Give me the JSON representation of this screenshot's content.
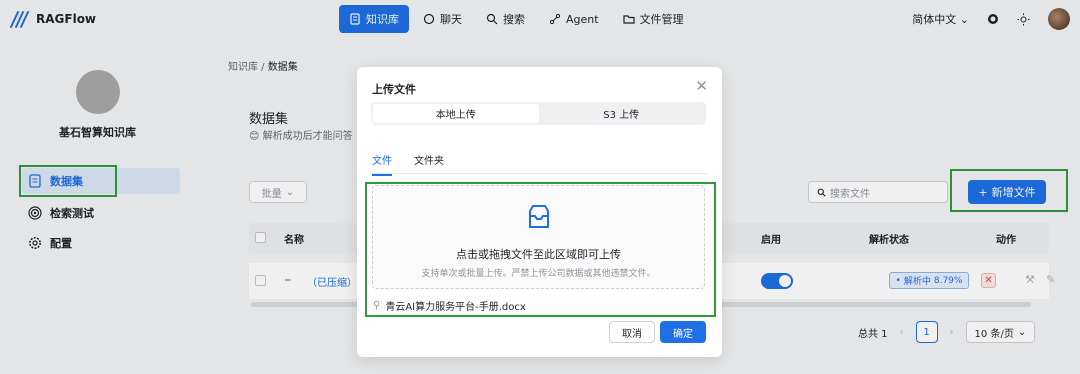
{
  "app": {
    "name": "RAGFlow"
  },
  "nav": {
    "items": [
      {
        "label": "知识库",
        "icon": "database-icon",
        "active": true
      },
      {
        "label": "聊天",
        "icon": "chat-icon"
      },
      {
        "label": "搜索",
        "icon": "search-icon"
      },
      {
        "label": "Agent",
        "icon": "agent-icon"
      },
      {
        "label": "文件管理",
        "icon": "folder-icon"
      }
    ],
    "language": "简体中文",
    "accent": "#1f6fe5"
  },
  "sidebar": {
    "kb_name": "基石智算知识库",
    "items": [
      {
        "label": "数据集",
        "icon": "dataset-icon",
        "active": true
      },
      {
        "label": "检索测试",
        "icon": "target-icon"
      },
      {
        "label": "配置",
        "icon": "gear-icon"
      }
    ]
  },
  "main": {
    "breadcrumb": {
      "root": "知识库",
      "current": "数据集"
    },
    "title": "数据集",
    "subtitle": "解析成功后才能问答",
    "batch_label": "批量",
    "search_placeholder": "搜索文件",
    "new_file_label": "新增文件",
    "table": {
      "headers": {
        "name": "名称",
        "enable": "启用",
        "parse_status": "解析状态",
        "action": "动作"
      },
      "rows": [
        {
          "name": "（已压缩）基",
          "enabled": true,
          "status_label": "解析中",
          "progress": "8.79%"
        }
      ]
    },
    "pagination": {
      "total": "总共 1",
      "page": "1",
      "page_size": "10 条/页"
    }
  },
  "modal": {
    "title": "上传文件",
    "segments": [
      "本地上传",
      "S3 上传"
    ],
    "tabs": [
      "文件",
      "文件夹"
    ],
    "dropzone_main": "点击或拖拽文件至此区域即可上传",
    "dropzone_hint": "支持单次或批量上传。严禁上传公司数据或其他违禁文件。",
    "file_name": "青云AI算力服务平台-手册.docx",
    "cancel": "取消",
    "ok": "确定"
  }
}
